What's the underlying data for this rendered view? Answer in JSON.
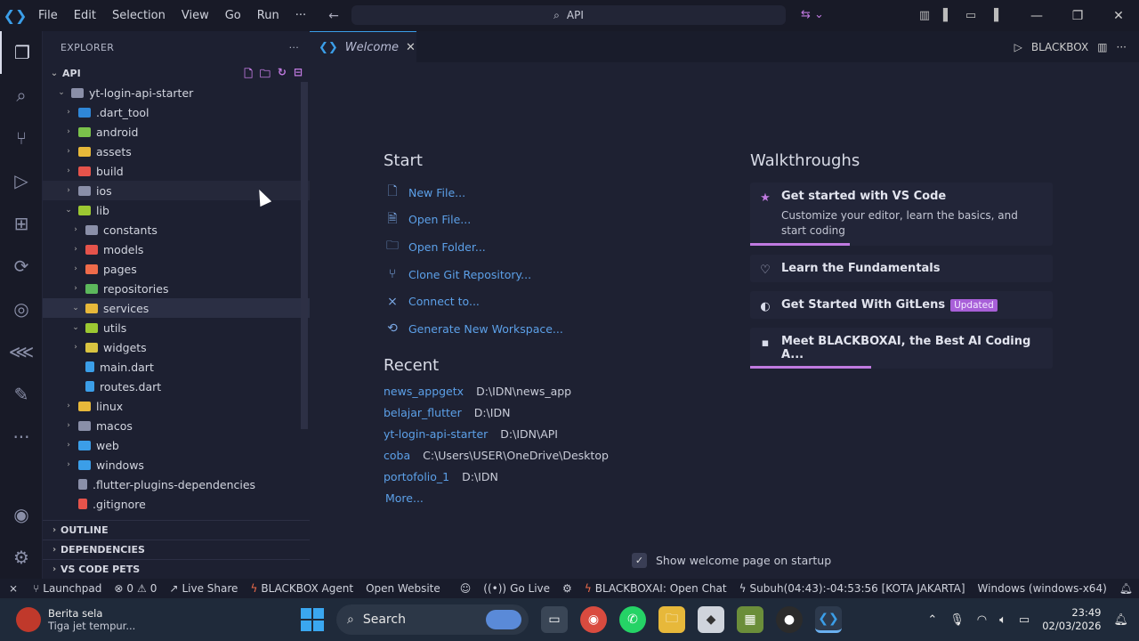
{
  "title_bar": {
    "menu": [
      "File",
      "Edit",
      "Selection",
      "View",
      "Go",
      "Run",
      "···"
    ],
    "command_center": "API"
  },
  "explorer": {
    "header": "EXPLORER",
    "root": "API",
    "tree": [
      {
        "label": "yt-login-api-starter",
        "depth": 1,
        "chev": "⌄",
        "color": "#8a8fa8"
      },
      {
        "label": ".dart_tool",
        "depth": 2,
        "chev": "›",
        "color": "#2f87d8"
      },
      {
        "label": "android",
        "depth": 2,
        "chev": "›",
        "color": "#7bc24b"
      },
      {
        "label": "assets",
        "depth": 2,
        "chev": "›",
        "color": "#e7b83a"
      },
      {
        "label": "build",
        "depth": 2,
        "chev": "›",
        "color": "#e5534b"
      },
      {
        "label": "ios",
        "depth": 2,
        "chev": "›",
        "color": "#8a8fa8"
      },
      {
        "label": "lib",
        "depth": 2,
        "chev": "⌄",
        "color": "#9cc832"
      },
      {
        "label": "constants",
        "depth": 3,
        "chev": "›",
        "color": "#8a8fa8"
      },
      {
        "label": "models",
        "depth": 3,
        "chev": "›",
        "color": "#e5534b"
      },
      {
        "label": "pages",
        "depth": 3,
        "chev": "›",
        "color": "#ef6b4a"
      },
      {
        "label": "repositories",
        "depth": 3,
        "chev": "›",
        "color": "#5cb85c"
      },
      {
        "label": "services",
        "depth": 3,
        "chev": "⌄",
        "color": "#e7b83a"
      },
      {
        "label": "utils",
        "depth": 3,
        "chev": "⌄",
        "color": "#9cc832"
      },
      {
        "label": "widgets",
        "depth": 3,
        "chev": "›",
        "color": "#d9c441"
      },
      {
        "label": "main.dart",
        "depth": 3,
        "chev": "",
        "color": "#3b9ee8"
      },
      {
        "label": "routes.dart",
        "depth": 3,
        "chev": "",
        "color": "#3b9ee8"
      },
      {
        "label": "linux",
        "depth": 2,
        "chev": "›",
        "color": "#e7b83a"
      },
      {
        "label": "macos",
        "depth": 2,
        "chev": "›",
        "color": "#8a8fa8"
      },
      {
        "label": "web",
        "depth": 2,
        "chev": "›",
        "color": "#3b9ee8"
      },
      {
        "label": "windows",
        "depth": 2,
        "chev": "›",
        "color": "#3b9ee8"
      },
      {
        "label": ".flutter-plugins-dependencies",
        "depth": 2,
        "chev": "",
        "color": "#8a8fa8"
      },
      {
        "label": ".gitignore",
        "depth": 2,
        "chev": "",
        "color": "#e5534b"
      }
    ],
    "sections": [
      "OUTLINE",
      "DEPENDENCIES",
      "VS CODE PETS"
    ]
  },
  "editor": {
    "tab_label": "Welcome",
    "tab_right": "BLACKBOX",
    "start_title": "Start",
    "start_links": [
      {
        "label": "New File...",
        "icon": "new-file-icon",
        "glyph": "🗋"
      },
      {
        "label": "Open File...",
        "icon": "open-file-icon",
        "glyph": "🗎"
      },
      {
        "label": "Open Folder...",
        "icon": "folder-icon",
        "glyph": "🗀"
      },
      {
        "label": "Clone Git Repository...",
        "icon": "git-icon",
        "glyph": "⑂"
      },
      {
        "label": "Connect to...",
        "icon": "remote-icon",
        "glyph": "⨯"
      },
      {
        "label": "Generate New Workspace...",
        "icon": "workspace-icon",
        "glyph": "⟲"
      }
    ],
    "recent_title": "Recent",
    "recent": [
      {
        "name": "news_appgetx",
        "path": "D:\\IDN\\news_app"
      },
      {
        "name": "belajar_flutter",
        "path": "D:\\IDN"
      },
      {
        "name": "yt-login-api-starter",
        "path": "D:\\IDN\\API"
      },
      {
        "name": "coba",
        "path": "C:\\Users\\USER\\OneDrive\\Desktop"
      },
      {
        "name": "portofolio_1",
        "path": "D:\\IDN"
      }
    ],
    "more": "More...",
    "walkthroughs_title": "Walkthroughs",
    "walkthroughs": [
      {
        "title": "Get started with VS Code",
        "desc": "Customize your editor, learn the basics, and start coding",
        "progress": 0.33,
        "badge": "",
        "icon": "star-icon",
        "glyph": "★",
        "iconColor": "#c07ae0"
      },
      {
        "title": "Learn the Fundamentals",
        "desc": "",
        "progress": 0,
        "badge": "",
        "icon": "lightbulb-icon",
        "glyph": "♡",
        "iconColor": "#b8bcd4"
      },
      {
        "title": "Get Started With GitLens",
        "desc": "",
        "progress": 0,
        "badge": "Updated",
        "icon": "gitlens-icon",
        "glyph": "◐",
        "iconColor": "#d9dcea"
      },
      {
        "title": "Meet BLACKBOXAI, the Best AI Coding A...",
        "desc": "",
        "progress": 0.4,
        "badge": "",
        "icon": "blackbox-icon",
        "glyph": "▪",
        "iconColor": "#d9dcea"
      }
    ],
    "show_on_startup": "Show welcome page on startup"
  },
  "status_bar": {
    "launchpad": "Launchpad",
    "errors": "0",
    "warnings": "0",
    "live_share": "Live Share",
    "blackbox_agent": "BLACKBOX Agent",
    "open_website": "Open Website",
    "go_live": "Go Live",
    "blackbox_chat": "BLACKBOXAI: Open Chat",
    "prayer": "Subuh(04:43):-04:53:56 [KOTA JAKARTA]",
    "platform": "Windows (windows-x64)"
  },
  "taskbar": {
    "news_title": "Berita sela",
    "news_sub": "Tiga jet tempur...",
    "search_label": "Search",
    "time": "23:49",
    "date": "02/03/2026"
  }
}
